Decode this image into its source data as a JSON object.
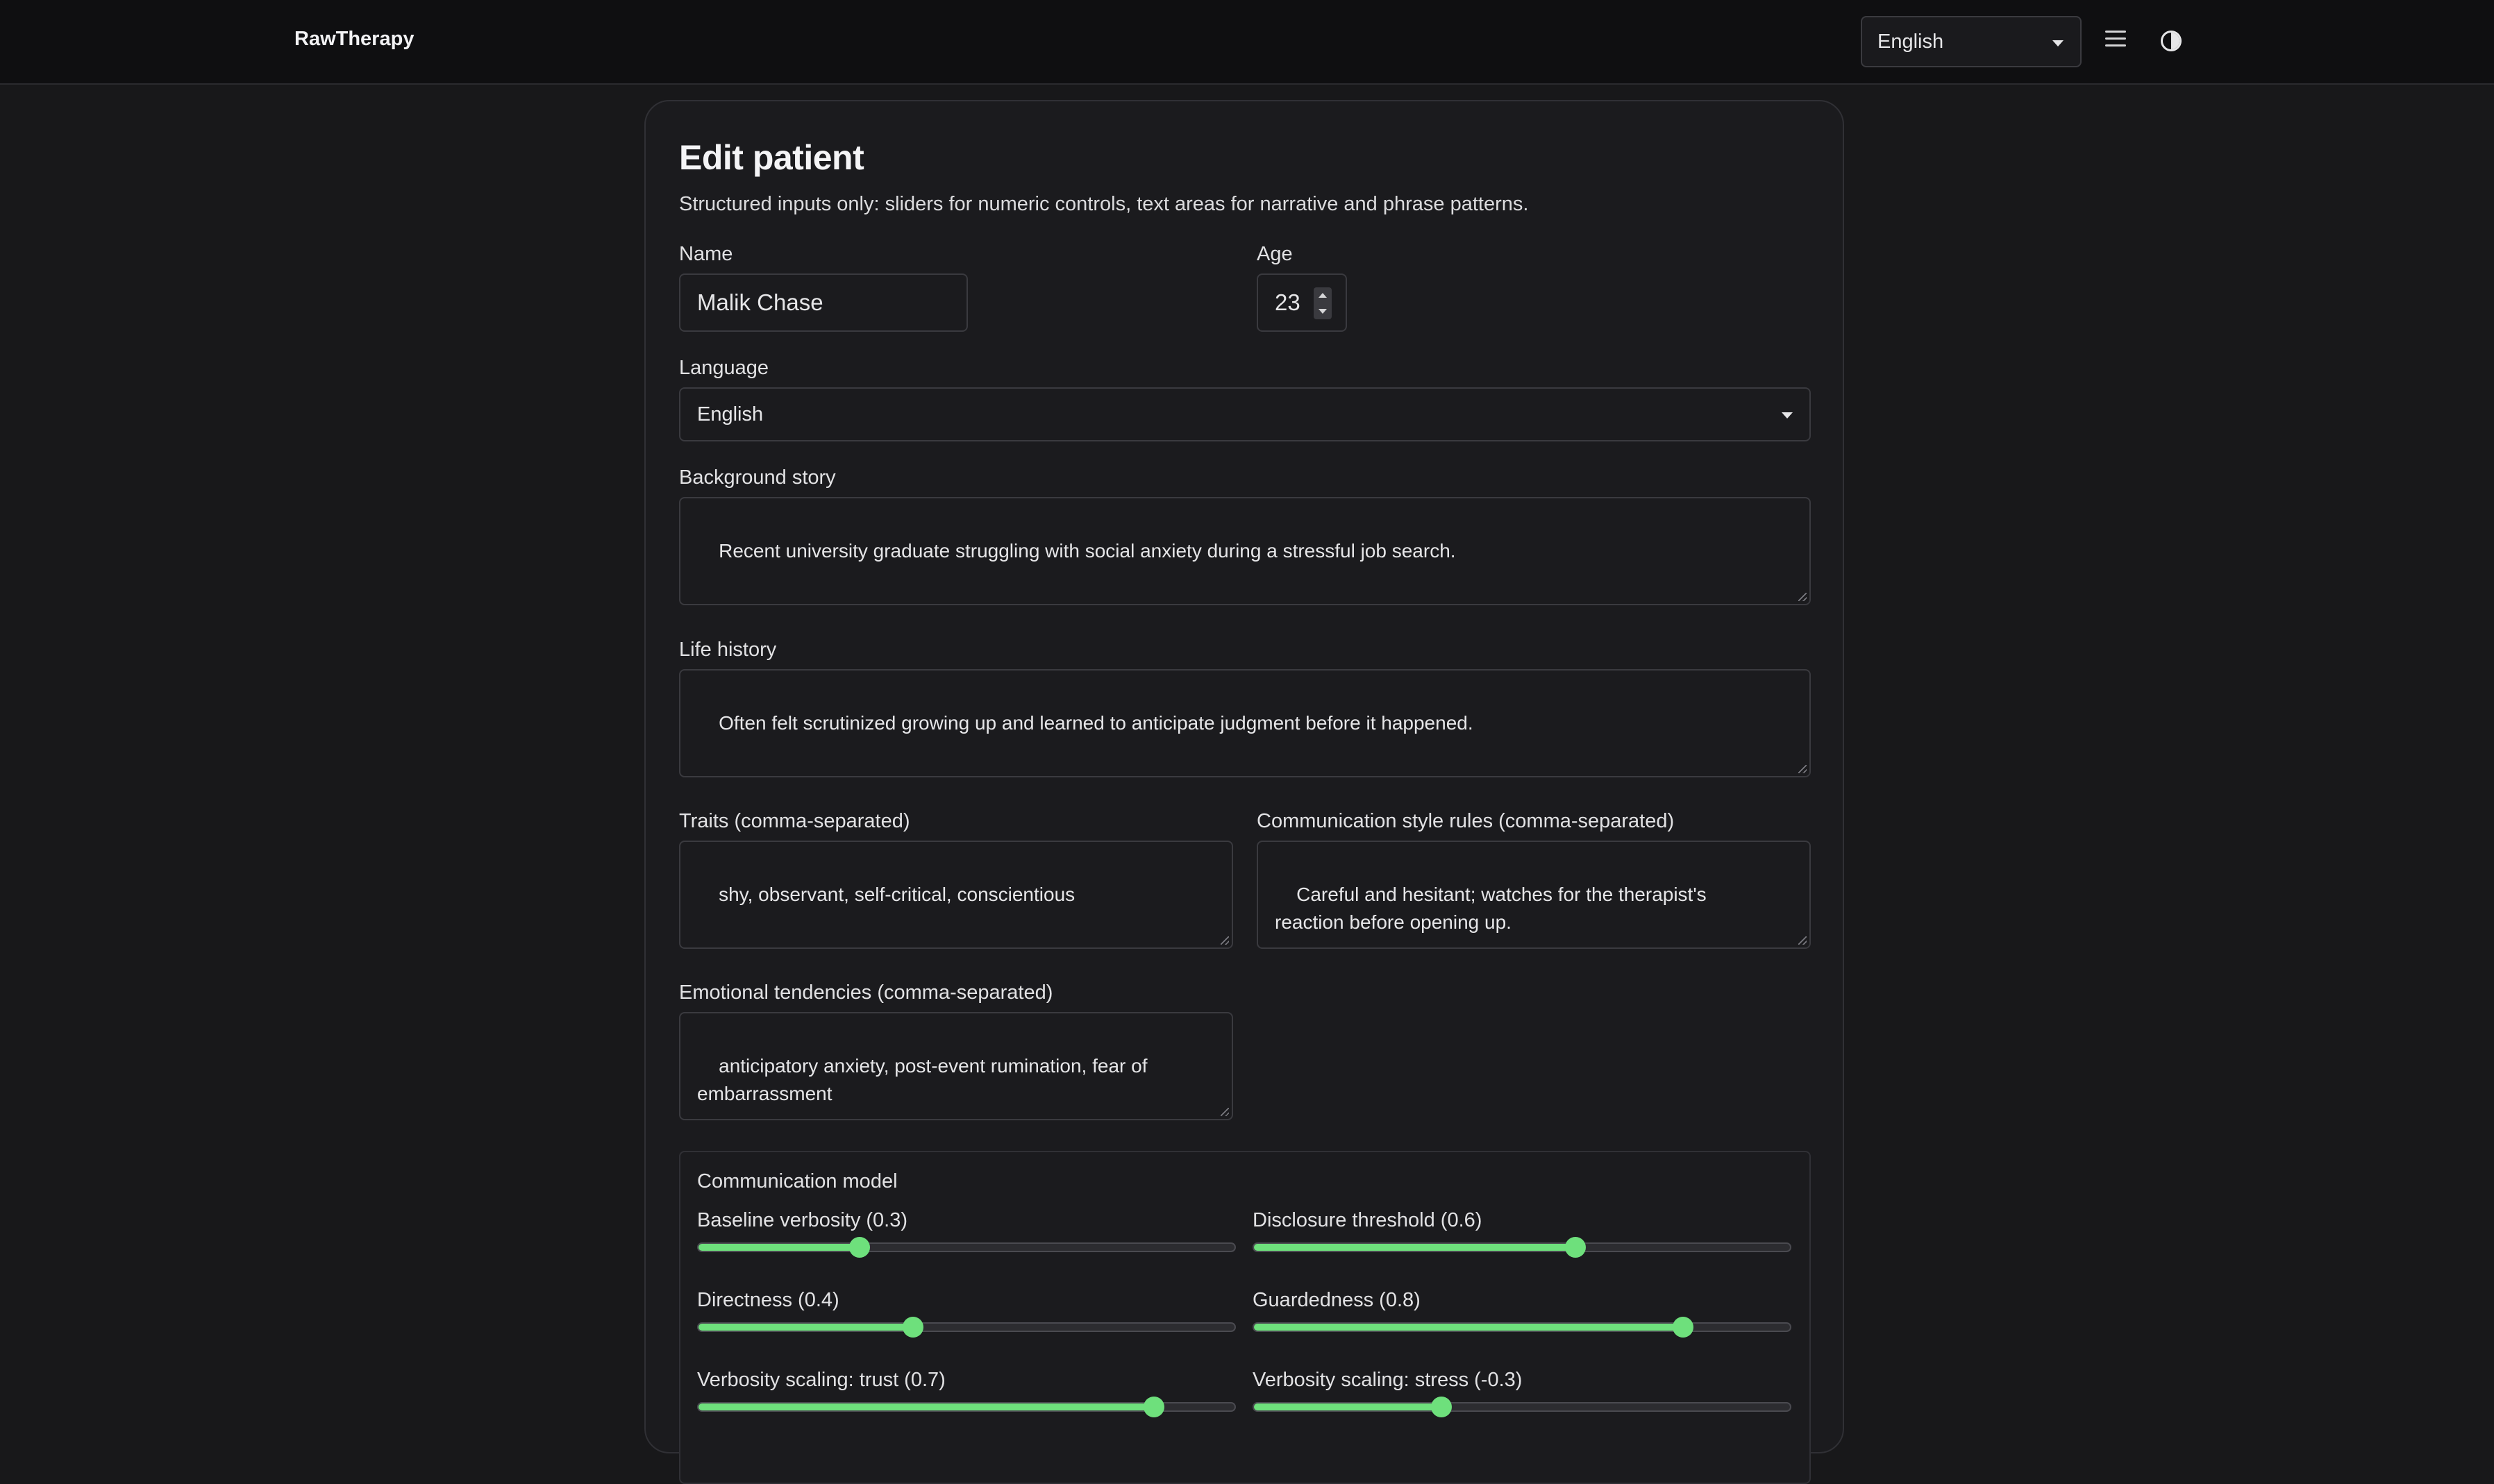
{
  "header": {
    "brand": "RawTherapy",
    "language_selected": "English"
  },
  "form": {
    "title": "Edit patient",
    "subtitle": "Structured inputs only: sliders for numeric controls, text areas for narrative and phrase patterns.",
    "name": {
      "label": "Name",
      "value": "Malik Chase"
    },
    "age": {
      "label": "Age",
      "value": "23"
    },
    "language": {
      "label": "Language",
      "value": "English"
    },
    "background_story": {
      "label": "Background story",
      "value": "Recent university graduate struggling with social anxiety during a stressful job search."
    },
    "life_history": {
      "label": "Life history",
      "value": "Often felt scrutinized growing up and learned to anticipate judgment before it happened."
    },
    "traits": {
      "label": "Traits (comma-separated)",
      "value": "shy, observant, self-critical, conscientious"
    },
    "communication_style": {
      "label": "Communication style rules (comma-separated)",
      "value": "Careful and hesitant; watches for the therapist's\nreaction before opening up."
    },
    "emotional_tendencies": {
      "label": "Emotional tendencies (comma-separated)",
      "value": "anticipatory anxiety, post-event rumination, fear of\nembarrassment"
    }
  },
  "communication_model": {
    "legend": "Communication model",
    "sliders": [
      {
        "label": "Baseline verbosity (0.3)",
        "value": 0.3,
        "min": 0,
        "max": 1
      },
      {
        "label": "Disclosure threshold (0.6)",
        "value": 0.6,
        "min": 0,
        "max": 1
      },
      {
        "label": "Directness (0.4)",
        "value": 0.4,
        "min": 0,
        "max": 1
      },
      {
        "label": "Guardedness (0.8)",
        "value": 0.8,
        "min": 0,
        "max": 1
      },
      {
        "label": "Verbosity scaling: trust (0.7)",
        "value": 0.7,
        "min": -1,
        "max": 1
      },
      {
        "label": "Verbosity scaling: stress (-0.3)",
        "value": -0.3,
        "min": -1,
        "max": 1
      }
    ]
  },
  "colors": {
    "accent": "#6ee07c",
    "background": "#18181a",
    "card": "#1b1b1e",
    "header": "#0f0f11"
  },
  "icons": {
    "menu": "menu-icon",
    "theme": "contrast-icon",
    "dropdown": "chevron-down-icon"
  }
}
